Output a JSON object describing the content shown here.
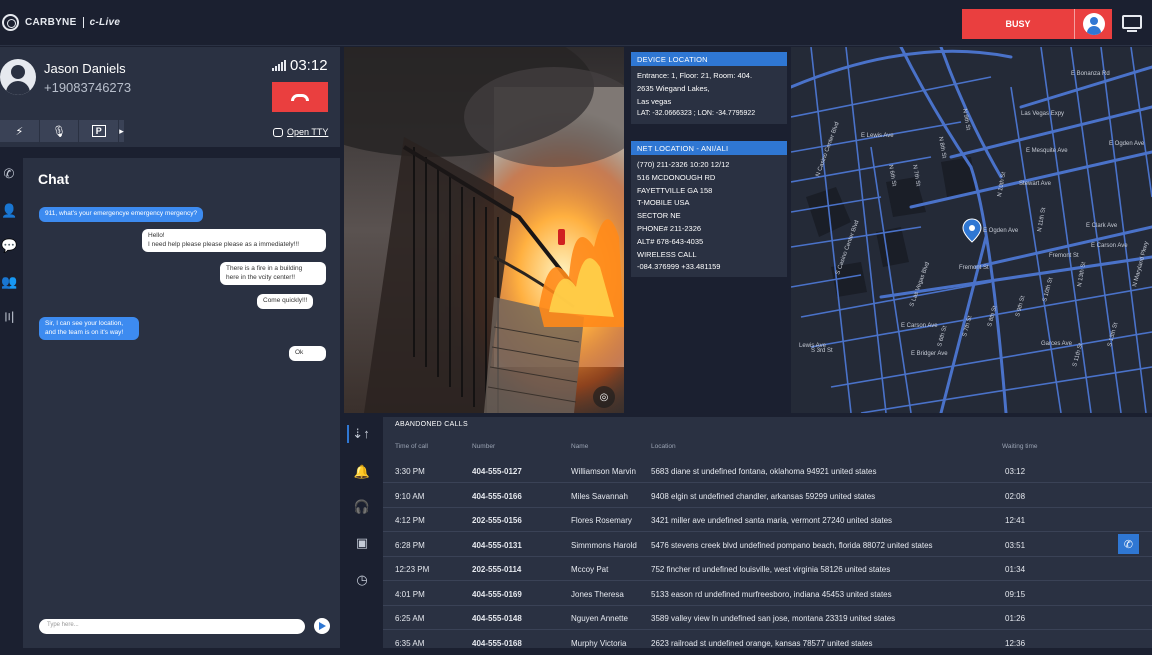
{
  "app": {
    "brand": "CARBYNE",
    "product": "c-Live",
    "status_button": "BUSY"
  },
  "caller": {
    "name": "Jason Daniels",
    "phone": "+19083746273",
    "timer": "03:12",
    "open_tty": "Open TTY"
  },
  "chat": {
    "title": "Chat",
    "messages": [
      {
        "from": "dispatcher",
        "text": "911, what's your emergencye emergency mergency?"
      },
      {
        "from": "caller",
        "text": "Hello!\nI need help please please please as a immediately!!!"
      },
      {
        "from": "caller",
        "text": "There is a fire in a building\nhere in the vcity center!!"
      },
      {
        "from": "caller",
        "text": "Come quickly!!!"
      },
      {
        "from": "dispatcher",
        "text": "Sir, I can see your location,\nand the team is on it's way!"
      },
      {
        "from": "caller",
        "text": "Ok"
      }
    ],
    "input_placeholder": "Type here..."
  },
  "device_location": {
    "title": "DEVICE LOCATION",
    "lines": [
      "Entrance: 1, Floor: 21, Room: 404.",
      "2635 Wiegand Lakes,",
      "Las vegas",
      "LAT: -32.0666323 ; LON: -34.7795922"
    ]
  },
  "net_location": {
    "title": "NET LOCATION - ANI/ALI",
    "lines": [
      "(770) 211-2326  10:20  12/12",
      "516 MCDONOUGH RD",
      "FAYETTVILLE GA 158",
      "T-MOBILE USA",
      "SECTOR NE",
      "PHONE# 211-2326",
      "ALT# 678-643-4035",
      "WIRELESS CALL",
      "-084.376999  +33.481159"
    ]
  },
  "map": {
    "streets": [
      "E Bonanza Rd",
      "Las Vegas Expy",
      "E Mesquite Ave",
      "Stewart Ave",
      "E Ogden Ave",
      "Fremont St",
      "E Carson Ave",
      "E Bridger Ave",
      "S Las Vegas Blvd",
      "S Casino Center Blvd",
      "E Lewis Ave",
      "N 9th St",
      "N 8th St",
      "N 7th St",
      "N 6th St",
      "N 10th St",
      "N 11th St",
      "N 13th St",
      "E Clark Ave",
      "S 3rd St",
      "S 6th St",
      "S 7th St",
      "S 8th St",
      "S 9th St",
      "S 10th St",
      "S 11th St",
      "S 13th St",
      "N Maryland Pkwy",
      "Garces Ave",
      "E Ogden Ave",
      "N Casino Center Blvd",
      "E Carson Ave",
      "Fremont St",
      "Lewis Ave"
    ]
  },
  "abandoned_calls": {
    "title": "ABANDONED CALLS",
    "columns": [
      "Time of call",
      "Number",
      "Name",
      "Location",
      "Waiting time"
    ],
    "rows": [
      [
        "3:30 PM",
        "404-555-0127",
        "Williamson Marvin",
        "5683 diane st undefined fontana, oklahoma 94921 united states",
        "03:12"
      ],
      [
        "9:10 AM",
        "404-555-0166",
        "Miles Savannah",
        "9408 elgin st undefined chandler, arkansas 59299 united states",
        "02:08"
      ],
      [
        "4:12 PM",
        "202-555-0156",
        "Flores Rosemary",
        "3421 miller ave undefined santa maria, vermont 27240 united states",
        "12:41"
      ],
      [
        "6:28 PM",
        "404-555-0131",
        "Simmmons Harold",
        "5476 stevens creek blvd undefined pompano beach, florida 88072 united states",
        "03:51"
      ],
      [
        "12:23 PM",
        "202-555-0114",
        "Mccoy Pat",
        "752 fincher rd undefined louisville, west virginia 58126 united states",
        "01:34"
      ],
      [
        "4:01 PM",
        "404-555-0169",
        "Jones Theresa",
        "5133 eason rd undefined murfreesboro, indiana 45453 united states",
        "09:15"
      ],
      [
        "6:25 AM",
        "404-555-0148",
        "Nguyen Annette",
        "3589 valley view ln undefined san jose, montana 23319 united states",
        "01:26"
      ],
      [
        "6:35 AM",
        "404-555-0168",
        "Murphy Victoria",
        "2623 railroad st undefined orange, kansas 78577 united states",
        "12:36"
      ]
    ]
  }
}
